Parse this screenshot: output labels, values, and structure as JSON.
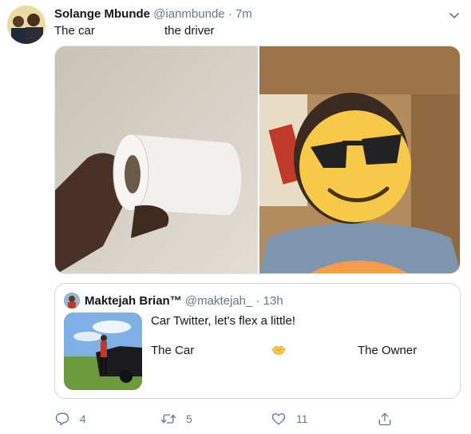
{
  "tweet": {
    "author_name": "Solange Mbunde",
    "author_handle": "@ianmbunde",
    "separator": "·",
    "timestamp": "7m",
    "text_left": "The car",
    "text_right": "the driver",
    "media": [
      {
        "icon": "toilet-paper-roll-photo"
      },
      {
        "icon": "man-selfie-with-sunglasses-emoji-photo"
      }
    ]
  },
  "quoted_tweet": {
    "author_name": "Maktejah Brian™",
    "author_handle": "@maktejah_",
    "separator": "·",
    "timestamp": "13h",
    "text_line1": "Car Twitter, let's flex a little!",
    "label_car": "The Car",
    "label_owner": "The Owner",
    "middle_icon": "handshake-emoji"
  },
  "actions": {
    "reply_count": "4",
    "retweet_count": "5",
    "like_count": "11"
  },
  "colors": {
    "muted": "#657786",
    "border": "#ccd6dd",
    "emoji_yellow": "#f7c948"
  }
}
